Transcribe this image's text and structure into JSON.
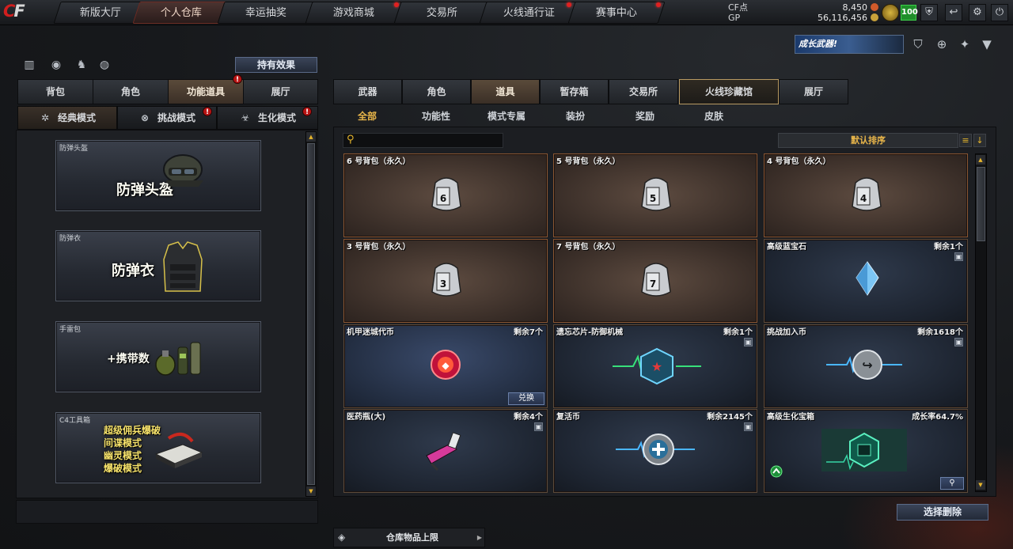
{
  "nav": {
    "logo": {
      "a": "C",
      "b": "F"
    },
    "tabs": [
      {
        "label": "新版大厅",
        "dot": false
      },
      {
        "label": "个人仓库",
        "dot": false,
        "active": true
      },
      {
        "label": "幸运抽奖",
        "dot": false
      },
      {
        "label": "游戏商城",
        "dot": true
      },
      {
        "label": "交易所",
        "dot": false
      },
      {
        "label": "火线通行证",
        "dot": true
      },
      {
        "label": "赛事中心",
        "dot": true
      }
    ]
  },
  "currency": {
    "cf_label": "CF点",
    "cf_value": "8,450",
    "gp_label": "GP",
    "gp_value": "56,116,456"
  },
  "level": "100",
  "promo": {
    "text": "成长武器!"
  },
  "left": {
    "effects_button": "持有效果",
    "tabs": [
      "背包",
      "角色",
      "功能道具",
      "展厅"
    ],
    "modes": [
      "经典模式",
      "挑战模式",
      "生化模式"
    ],
    "cards": [
      {
        "caption": "防弹头盔",
        "title": "防弹头盔"
      },
      {
        "caption": "防弹衣",
        "title": "防弹衣"
      },
      {
        "caption": "手雷包",
        "title": "+携带数"
      },
      {
        "caption": "C4工具箱",
        "lines": [
          "超级佣兵爆破",
          "间谍模式",
          "幽灵模式",
          "爆破模式"
        ]
      }
    ]
  },
  "right": {
    "tabs": [
      "武器",
      "角色",
      "道具",
      "暂存箱",
      "交易所",
      "火线珍藏馆",
      "展厅"
    ],
    "subtabs": [
      "全部",
      "功能性",
      "模式专属",
      "装扮",
      "奖励",
      "皮肤"
    ],
    "search_placeholder": "",
    "sort_label": "默认排序",
    "items": [
      {
        "name": "6 号背包（永久）",
        "bag": "6"
      },
      {
        "name": "5 号背包（永久）",
        "bag": "5"
      },
      {
        "name": "4 号背包（永久）",
        "bag": "4"
      },
      {
        "name": "3 号背包（永久）",
        "bag": "3"
      },
      {
        "name": "7 号背包（永久）",
        "bag": "7"
      },
      {
        "name": "高级蓝宝石",
        "count": "剩余1个"
      },
      {
        "name": "机甲迷城代币",
        "count": "剩余7个",
        "button": "兑换"
      },
      {
        "name": "遗忘芯片-防御机械",
        "count": "剩余1个"
      },
      {
        "name": "挑战加入币",
        "count": "剩余1618个"
      },
      {
        "name": "医药瓶(大)",
        "count": "剩余4个"
      },
      {
        "name": "复活币",
        "count": "剩余2145个"
      },
      {
        "name": "高级生化宝箱",
        "count": "成长率64.7%"
      }
    ],
    "delete_button": "选择删除",
    "bottom_tab": "仓库物品上限"
  },
  "colors": {
    "accent": "#e9b64a",
    "border": "#8a5632",
    "alert": "#e02020"
  }
}
